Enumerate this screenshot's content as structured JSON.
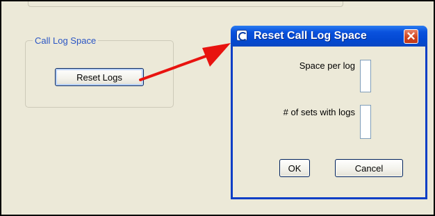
{
  "group": {
    "legend": "Call Log Space",
    "reset_button_label": "Reset Logs"
  },
  "dialog": {
    "title": "Reset Call Log Space",
    "close_glyph": "✕",
    "space_per_log_label": "Space per log",
    "space_per_log_value": "",
    "sets_with_logs_label": "# of sets with logs",
    "sets_with_logs_value": "",
    "ok_label": "OK",
    "cancel_label": "Cancel"
  },
  "annotation": {
    "arrow_color": "#e8130f"
  },
  "colors": {
    "window_face": "#ece9d8",
    "titlebar_blue": "#0a52de",
    "legend_blue": "#2a55c4"
  }
}
